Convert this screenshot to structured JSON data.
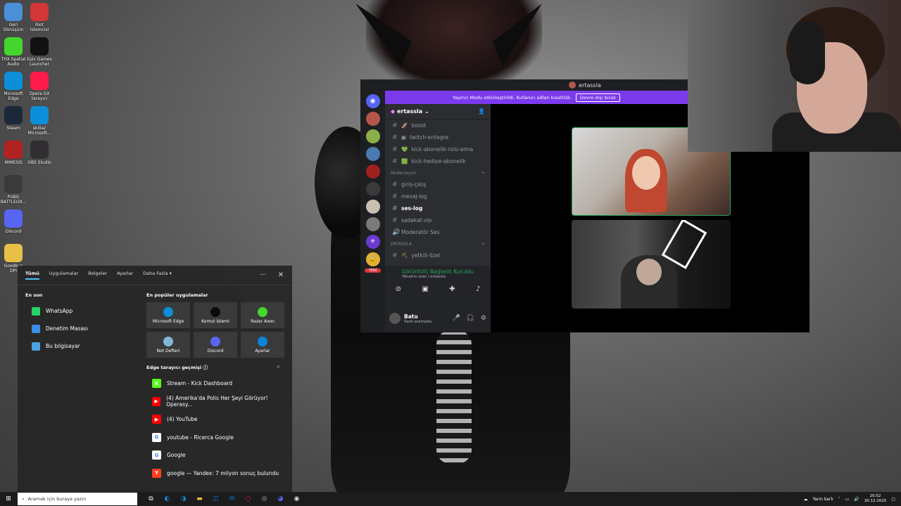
{
  "desktop_icons": [
    {
      "label": "Geri Dönüşüm",
      "icon": "recycle-bin-icon",
      "color": "#4a90d9"
    },
    {
      "label": "Riot İstemcisi",
      "icon": "riot-icon",
      "color": "#d13639"
    },
    {
      "label": "THX Spatial Audio",
      "icon": "thx-icon",
      "color": "#44d62c"
    },
    {
      "label": "Epic Games Launcher",
      "icon": "epic-icon",
      "color": "#111111"
    },
    {
      "label": "Microsoft Edge",
      "icon": "edge-icon",
      "color": "#0c8fd8"
    },
    {
      "label": "Opera GX tarayıcı",
      "icon": "opera-icon",
      "color": "#ff1b4b"
    },
    {
      "label": "Steam",
      "icon": "steam-icon",
      "color": "#1b2838"
    },
    {
      "label": "skillaz Microsoft...",
      "icon": "edge-icon",
      "color": "#0c8fd8"
    },
    {
      "label": "MIMESIS",
      "icon": "mimesis-icon",
      "color": "#b22222"
    },
    {
      "label": "OBS Studio",
      "icon": "obs-icon",
      "color": "#302e31"
    },
    {
      "label": "PUBG BATTLEGR...",
      "icon": "pubg-icon",
      "color": "#3a3a3a"
    },
    {
      "label": "Discord",
      "icon": "discord-icon",
      "color": "#5865f2"
    },
    {
      "label": "Goodbye DPI",
      "icon": "folder-icon",
      "color": "#e8c048"
    }
  ],
  "discord": {
    "title": "ertassla",
    "banner_text": "Yayıncı Modu etkinleştirildi. Kullanıcı adları kısaltıldı.",
    "banner_button": "Devre dışı bırak",
    "server_name": "ertassla",
    "channels_top": [
      {
        "name": "boost",
        "emoji": "🚀"
      },
      {
        "name": "twitch-entegre",
        "emoji": "▣"
      },
      {
        "name": "kick-abonelik-rolü-alma",
        "emoji": "💚"
      },
      {
        "name": "kick-hediye-abonelik",
        "emoji": "🟩"
      }
    ],
    "category_mod": "Moderasyon",
    "channels_mod": [
      {
        "name": "giriş-çıkış",
        "active": false
      },
      {
        "name": "mesaj-log",
        "active": false
      },
      {
        "name": "ses-log",
        "active": true
      },
      {
        "name": "sadakat-vip",
        "active": false
      },
      {
        "name": "Moderatör Ses",
        "active": false
      }
    ],
    "category_ertassla": "ERTASSLA",
    "channel_yetkili": "yetkili-özel",
    "voice_status": "Görüntülü Bağlantı Kuruldu",
    "voice_sub": "Yönetim özel / ertassla",
    "user_name": "Batu",
    "user_status": "Sesli aramada",
    "new_badge": "YENİ"
  },
  "startmenu": {
    "tabs": [
      "Tümü",
      "Uygulamalar",
      "Belgeler",
      "Ayarlar",
      "Daha Fazla ▾"
    ],
    "recent_title": "En son",
    "recent": [
      {
        "label": "WhatsApp",
        "icon": "whatsapp-icon",
        "color": "#25d366"
      },
      {
        "label": "Denetim Masası",
        "icon": "control-panel-icon",
        "color": "#3a8ee6"
      },
      {
        "label": "Bu bilgisayar",
        "icon": "computer-icon",
        "color": "#4aa3df"
      }
    ],
    "popular_title": "En popüler uygulamalar",
    "popular": [
      {
        "label": "Microsoft Edge",
        "icon": "edge-icon",
        "color": "#0c8fd8"
      },
      {
        "label": "Komut İstemi",
        "icon": "terminal-icon",
        "color": "#0c0c0c"
      },
      {
        "label": "Razer Axon",
        "icon": "razer-icon",
        "color": "#44d62c"
      },
      {
        "label": "Not Defteri",
        "icon": "notepad-icon",
        "color": "#7fb8d6"
      },
      {
        "label": "Discord",
        "icon": "discord-icon",
        "color": "#5865f2"
      },
      {
        "label": "Ayarlar",
        "icon": "gear-icon",
        "color": "#0a84d6"
      }
    ],
    "edge_history_title": "Edge tarayıcı geçmişi",
    "history": [
      {
        "label": "Stream - Kick Dashboard",
        "icon": "kick-icon",
        "color": "#53fc18",
        "glyph": "K"
      },
      {
        "label": "(4) Amerika'da Polis Her Şeyi Görüyor! Operasy...",
        "icon": "youtube-icon",
        "color": "#ff0000",
        "glyph": "▶"
      },
      {
        "label": "(4) YouTube",
        "icon": "youtube-icon",
        "color": "#ff0000",
        "glyph": "▶"
      },
      {
        "label": "youtube - Ricerca Google",
        "icon": "google-icon",
        "color": "#ffffff",
        "glyph": "G"
      },
      {
        "label": "Google",
        "icon": "google-icon",
        "color": "#ffffff",
        "glyph": "G"
      },
      {
        "label": "google — Yandex: 7 milyon sonuç bulundu",
        "icon": "yandex-icon",
        "color": "#fc3f1d",
        "glyph": "Y"
      }
    ]
  },
  "taskbar": {
    "search_placeholder": "Aramak için buraya yazın",
    "weather": "Yarın karlı",
    "time": "20:52",
    "date": "30.12.2025"
  }
}
